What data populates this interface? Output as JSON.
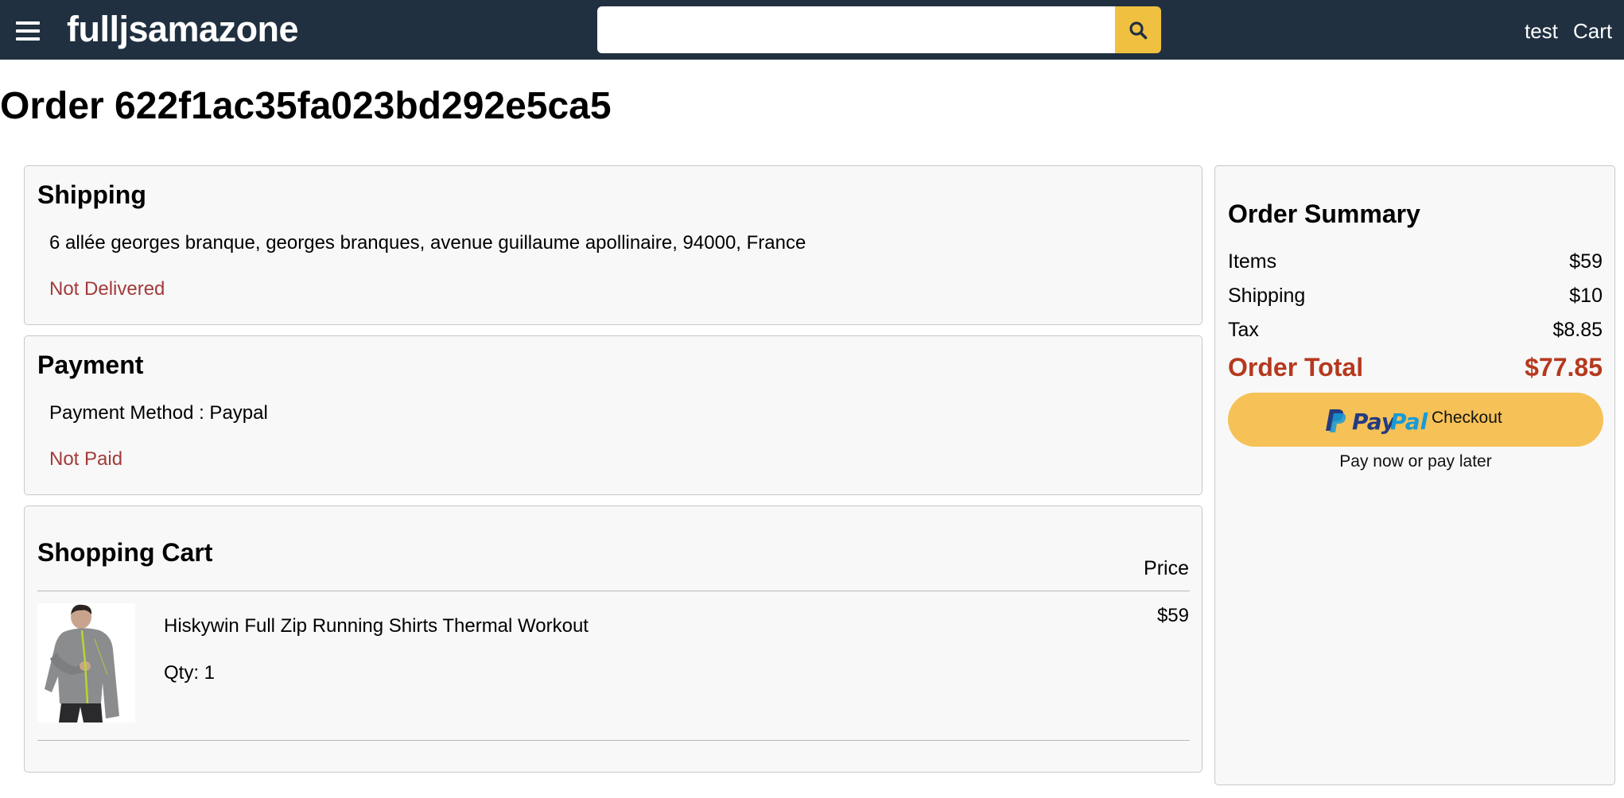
{
  "header": {
    "brand": "fulljsamazone",
    "search": {
      "value": "",
      "placeholder": ""
    },
    "user_label": "test",
    "cart_label": "Cart",
    "colors": {
      "bar": "#203040",
      "search_button": "#f0c040"
    }
  },
  "page_title": "Order 622f1ac35fa023bd292e5ca5",
  "shipping": {
    "heading": "Shipping",
    "address": "6 allée georges branque, georges branques, avenue guillaume apollinaire, 94000, France",
    "status": "Not Delivered"
  },
  "payment": {
    "heading": "Payment",
    "method": "Payment Method : Paypal",
    "status": "Not Paid"
  },
  "cart": {
    "heading": "Shopping Cart",
    "price_header": "Price",
    "items": [
      {
        "name": "Hiskywin Full Zip Running Shirts Thermal Workout",
        "qty": "Qty: 1",
        "price": "$59"
      }
    ]
  },
  "summary": {
    "heading": "Order Summary",
    "rows": [
      {
        "label": "Items",
        "value": "$59"
      },
      {
        "label": "Shipping",
        "value": "$10"
      },
      {
        "label": "Tax",
        "value": "$8.85"
      }
    ],
    "total_label": "Order Total",
    "total_value": "$77.85",
    "paypal": {
      "logo_pay": "Pay",
      "logo_pal": "Pal",
      "button_label": "Checkout",
      "tagline": "Pay now or pay later",
      "colors": {
        "button": "#f6c157",
        "pay": "#253b80",
        "pal": "#179bd7"
      }
    }
  },
  "colors": {
    "status_red": "#a33a3a",
    "total": "#b5391e"
  }
}
